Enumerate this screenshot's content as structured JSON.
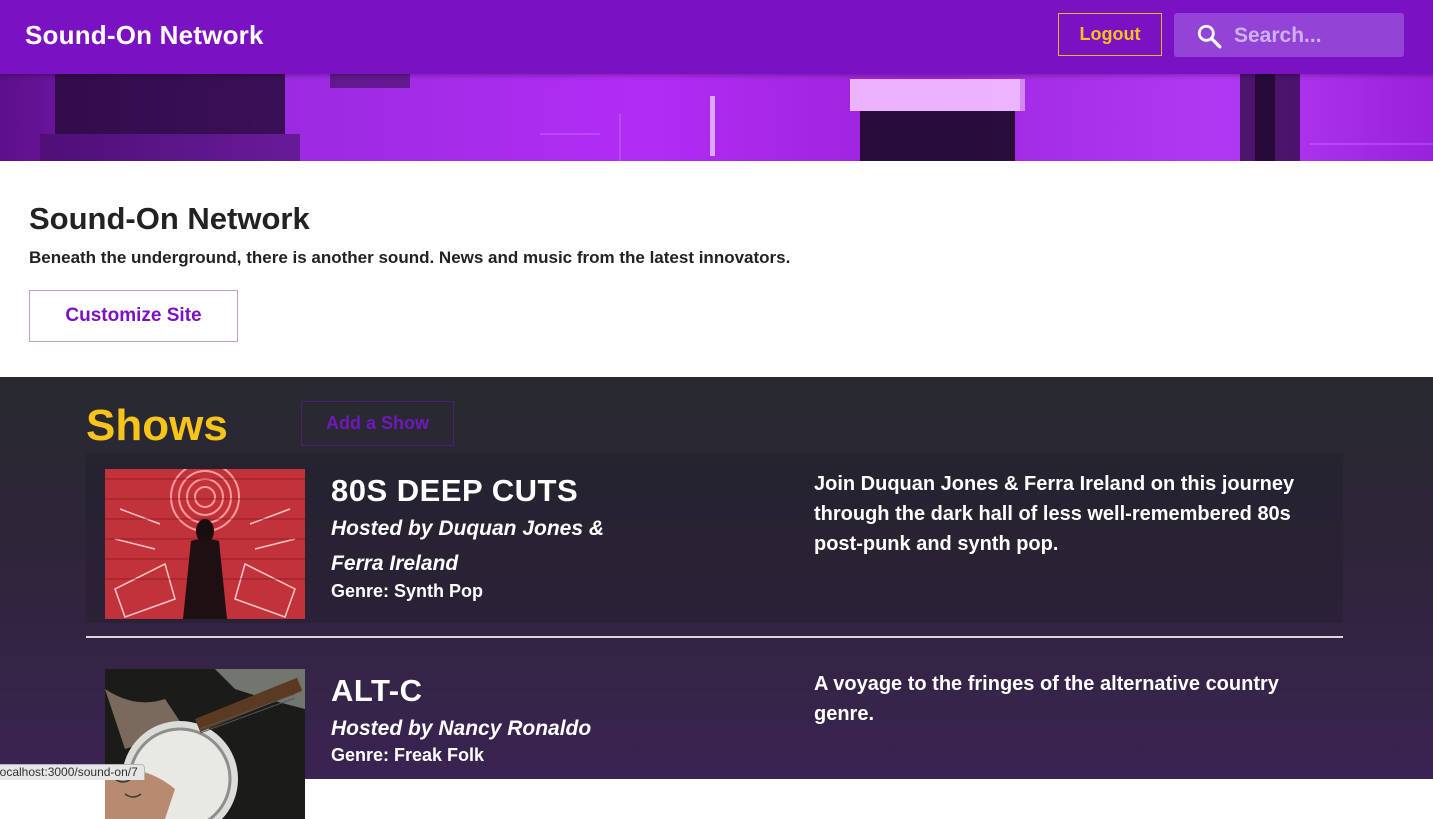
{
  "header": {
    "brand": "Sound-On Network",
    "logout_label": "Logout",
    "search_placeholder": "Search..."
  },
  "intro": {
    "title": "Sound-On Network",
    "tagline": "Beneath the underground, there is another sound. News and music from the latest innovators.",
    "customize_label": "Customize Site"
  },
  "shows_section": {
    "heading": "Shows",
    "add_show_label": "Add a Show",
    "shows": [
      {
        "title": "80S DEEP CUTS",
        "host": "Hosted by Duquan Jones & Ferra Ireland",
        "genre": "Genre: Synth Pop",
        "description": "Join Duquan Jones & Ferra Ireland on this journey through the dark hall of less well-remembered 80s post-punk and synth pop."
      },
      {
        "title": "ALT-C",
        "host": "Hosted by Nancy Ronaldo",
        "genre": "Genre: Freak Folk",
        "description": "A voyage to the fringes of the alternative country genre."
      }
    ]
  },
  "status_bar": {
    "url": "localhost:3000/sound-on/7"
  },
  "colors": {
    "header_bg": "#7a12c3",
    "accent_yellow": "#f7c41a",
    "brand_purple": "#7a12c3"
  }
}
